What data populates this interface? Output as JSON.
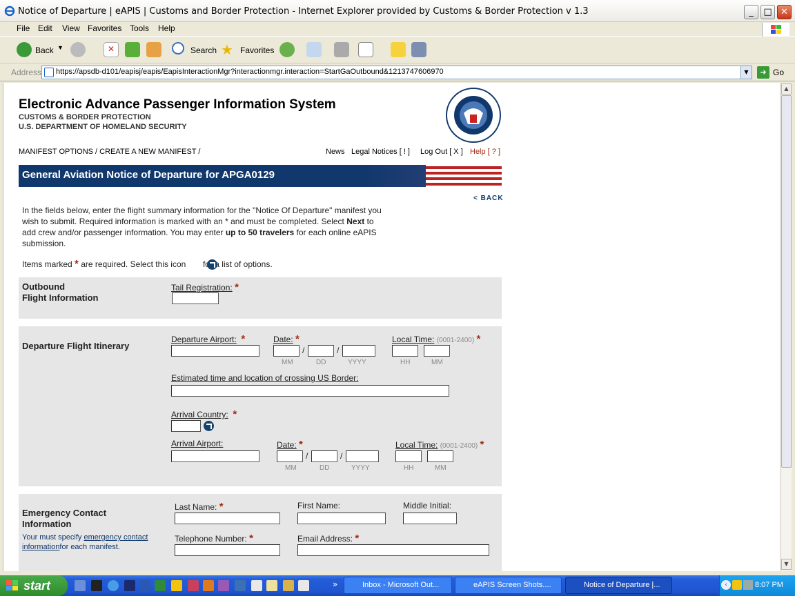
{
  "window": {
    "title": "Notice of Departure | eAPIS | Customs and Border Protection - Internet Explorer provided by Customs & Border Protection v 1.3"
  },
  "menu": [
    "File",
    "Edit",
    "View",
    "Favorites",
    "Tools",
    "Help"
  ],
  "toolbar": {
    "back": "Back",
    "search": "Search",
    "favorites": "Favorites"
  },
  "address": {
    "label": "Address",
    "url": "https://apsdb-d101/eapisj/eapis/EapisInteractionMgr?interactionmgr.interaction=StartGaOutbound&1213747606970",
    "go": "Go"
  },
  "header": {
    "title": "Electronic Advance Passenger Information System",
    "sub1": "CUSTOMS & BORDER PROTECTION",
    "sub2": "U.S. DEPARTMENT OF HOMELAND SECURITY",
    "breadcrumb": "MANIFEST OPTIONS / CREATE A NEW MANIFEST /",
    "links": {
      "news": "News",
      "legal": "Legal Notices [ ! ]",
      "logout": "Log Out [ X ]",
      "help": "Help [ ? ]"
    },
    "seal": "U.S. DEPARTMENT OF HOMELAND SECURITY"
  },
  "banner": {
    "title": "General Aviation Notice of Departure for APGA0129"
  },
  "back_link": "< BACK",
  "intro": {
    "p1": "In the fields below, enter the flight summary information for the \"Notice Of Departure\" manifest you",
    "p2a": "wish to submit. Required information is marked with an * and must be completed. Select ",
    "p2b": "Next",
    "p2c": " to",
    "p3a": "add crew and/or passenger information. You may enter ",
    "p3b": "up to 50 travelers",
    "p3c": " for each online eAPIS",
    "p4": "submission.",
    "req_a": "Items marked ",
    "req_star": "*",
    "req_b": " are required. Select this icon ",
    "req_c": " for a list of options."
  },
  "outbound": {
    "title1": "Outbound",
    "title2": "Flight Information",
    "tail_label": "Tail Registration:",
    "tail_value": ""
  },
  "itinerary": {
    "title": "Departure Flight Itinerary",
    "dep_airport": "Departure Airport:",
    "date": "Date:",
    "local_time": "Local Time:",
    "time_hint": "(0001-2400)",
    "mm": "MM",
    "dd": "DD",
    "yyyy": "YYYY",
    "hh": "HH",
    "min": "MM",
    "slash": "/",
    "border": "Estimated time and location of crossing US Border:",
    "arr_country": "Arrival Country:",
    "arr_airport": "Arrival Airport:"
  },
  "emergency": {
    "title1": "Emergency Contact",
    "title2": "Information",
    "note_a": "Your must specify ",
    "note_link": "emergency contact information",
    "note_b": "for each manifest.",
    "last": "Last Name:",
    "first": "First Name:",
    "middle": "Middle Initial:",
    "phone": "Telephone Number:",
    "email": "Email Address:"
  },
  "taskbar": {
    "start": "start",
    "tasks": [
      "Inbox - Microsoft Out...",
      "eAPIS Screen Shots....",
      "Notice of Departure |..."
    ],
    "clock": "8:07 PM"
  },
  "colors": {
    "banner": "#11386d",
    "required": "#a02b12",
    "section": "#e6e6e6"
  }
}
